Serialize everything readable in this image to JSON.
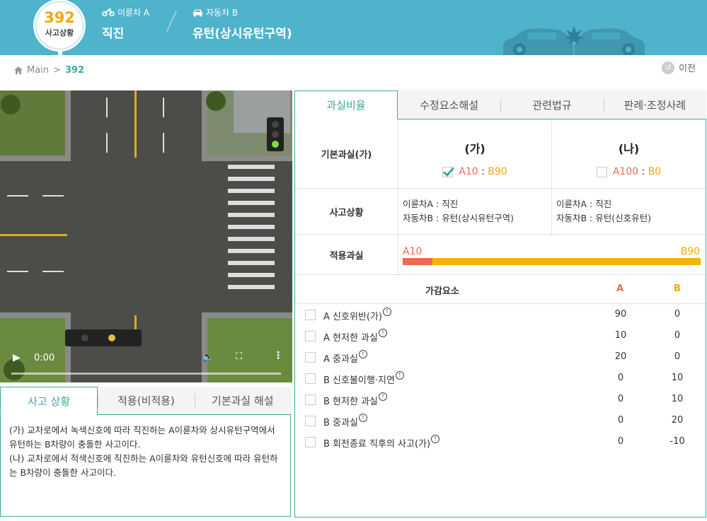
{
  "header": {
    "badge_number": "392",
    "badge_label": "사고상황",
    "party_a_tag": "이륜차 A",
    "party_a_value": "직진",
    "party_b_tag": "자동차 B",
    "party_b_value": "유턴(상시유턴구역)",
    "icons": [
      "motorcycle-icon",
      "car-icon",
      "crash-cars-illustration"
    ]
  },
  "breadcrumb": {
    "home": "Main",
    "separator": ">",
    "current": "392"
  },
  "back_button": "이전",
  "video": {
    "time": "0:00",
    "play_icon": "▶",
    "volume_icon": "volume-icon",
    "fullscreen_icon": "fullscreen-icon",
    "more_icon": "⋮"
  },
  "left_tabs": [
    "사고 상황",
    "적용(비적용)",
    "기본과실 해설"
  ],
  "description": {
    "line1": "(가) 교차로에서 녹색신호에 따라 직진하는 A이륜차와 상시유턴구역에서 유턴하는 B차량이 충돌한 사고이다.",
    "line2": "(나) 교차로에서 적색신호에 직진하는 A이륜차와 유턴신호에 따라 유턴하는 B차량이 충돌한 사고이다."
  },
  "right_tabs": [
    "과실비율",
    "수정요소해설",
    "관련법규",
    "판례·조정사례"
  ],
  "basic": {
    "label": "기본과실(가)",
    "ga": {
      "title": "(가)",
      "a": "A10",
      "sep": ":",
      "b": "B90",
      "checked": true
    },
    "na": {
      "title": "(나)",
      "a": "A100",
      "sep": ":",
      "b": "B0",
      "checked": false
    }
  },
  "situation": {
    "label": "사고상황",
    "ga_line1": "이륜차A : 직진",
    "ga_line2": "자동차B : 유턴(상시유턴구역)",
    "na_line1": "이륜차A : 직진",
    "na_line2": "자동차B : 유턴(신호유턴)"
  },
  "applied": {
    "label": "적용과실",
    "a": "A10",
    "b": "B90",
    "a_share": 0.1
  },
  "factors_header": {
    "name": "가감요소",
    "a": "A",
    "b": "B"
  },
  "factors": [
    {
      "name": "A 신호위반(가)",
      "a": "90",
      "b": "0"
    },
    {
      "name": "A 현저한 과실",
      "a": "10",
      "b": "0"
    },
    {
      "name": "A 중과실",
      "a": "20",
      "b": "0"
    },
    {
      "name": "B 신호불이행·지연",
      "a": "0",
      "b": "10"
    },
    {
      "name": "B 현저한 과실",
      "a": "0",
      "b": "10"
    },
    {
      "name": "B 중과실",
      "a": "0",
      "b": "20"
    },
    {
      "name": "B 회전종료 직후의 사고(가)",
      "a": "0",
      "b": "-10"
    }
  ],
  "info_glyph": "!",
  "colors": {
    "accent": "#3ea99f",
    "header": "#4fb3cc",
    "party_a": "#ec6a4f",
    "party_b": "#f5a80a"
  }
}
